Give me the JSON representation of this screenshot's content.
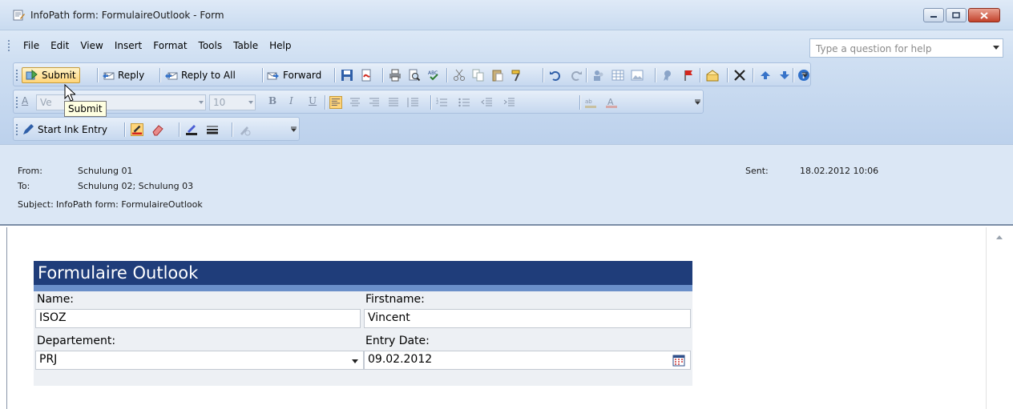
{
  "window": {
    "title": "InfoPath form: FormulaireOutlook - Form"
  },
  "menu": {
    "items": [
      "File",
      "Edit",
      "View",
      "Insert",
      "Format",
      "Tools",
      "Table",
      "Help"
    ],
    "help_placeholder": "Type a question for help"
  },
  "toolbar": {
    "submit_label": "Submit",
    "reply_label": "Reply",
    "reply_all_label": "Reply to All",
    "forward_label": "Forward",
    "font_name": "Ve",
    "font_size": "10",
    "ink_label": "Start Ink Entry"
  },
  "tooltip": {
    "text": "Submit"
  },
  "header": {
    "from_label": "From:",
    "from_value": "Schulung 01",
    "to_label": "To:",
    "to_value": "Schulung 02; Schulung 03",
    "subject_label": "Subject:",
    "subject_value": "InfoPath form: FormulaireOutlook",
    "sent_label": "Sent:",
    "sent_value": "18.02.2012 10:06"
  },
  "form": {
    "title": "Formulaire Outlook",
    "name_label": "Name:",
    "name_value": "ISOZ",
    "firstname_label": "Firstname:",
    "firstname_value": "Vincent",
    "department_label": "Departement:",
    "department_value": "PRJ",
    "entry_date_label": "Entry Date:",
    "entry_date_value": "09.02.2012"
  },
  "colors": {
    "form_title_bg": "#1f3d7a",
    "form_band": "#6a8fc9",
    "header_bg": "#dbe7f5",
    "toolbar_bg": "#cfdff2"
  }
}
